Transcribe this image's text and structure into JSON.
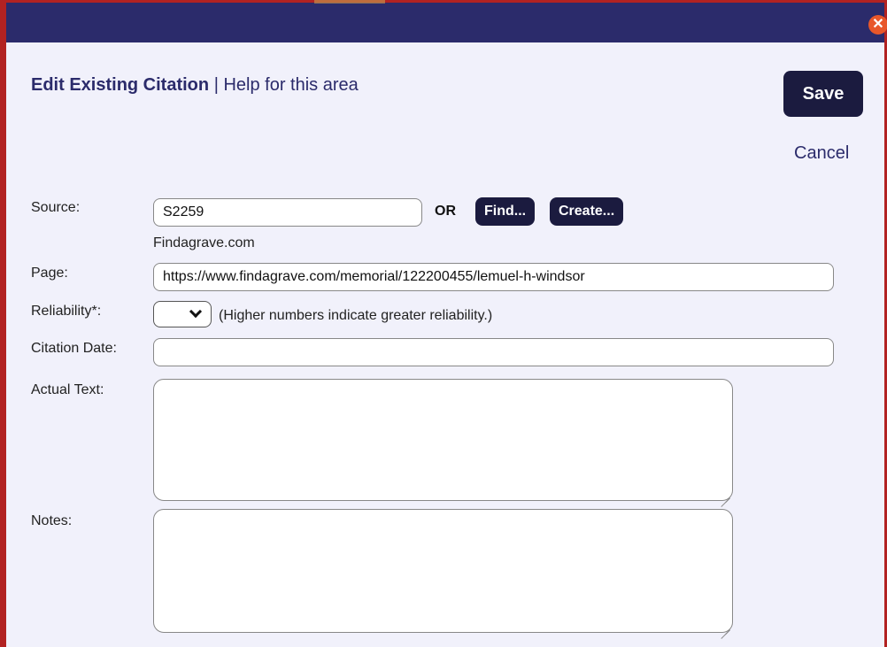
{
  "dialog": {
    "close_symbol": "✕"
  },
  "header": {
    "title": "Edit Existing Citation",
    "separator": "|",
    "help_link": "Help for this area"
  },
  "actions": {
    "save_label": "Save",
    "cancel_label": "Cancel"
  },
  "form": {
    "source": {
      "label": "Source:",
      "value": "S2259",
      "or_text": "OR",
      "find_label": "Find...",
      "create_label": "Create...",
      "source_name": "Findagrave.com"
    },
    "page": {
      "label": "Page:",
      "value": "https://www.findagrave.com/memorial/122200455/lemuel-h-windsor"
    },
    "reliability": {
      "label": "Reliability*:",
      "value": "",
      "hint": "(Higher numbers indicate greater reliability.)"
    },
    "citation_date": {
      "label": "Citation Date:",
      "value": ""
    },
    "actual_text": {
      "label": "Actual Text:",
      "value": ""
    },
    "notes": {
      "label": "Notes:",
      "value": ""
    }
  }
}
